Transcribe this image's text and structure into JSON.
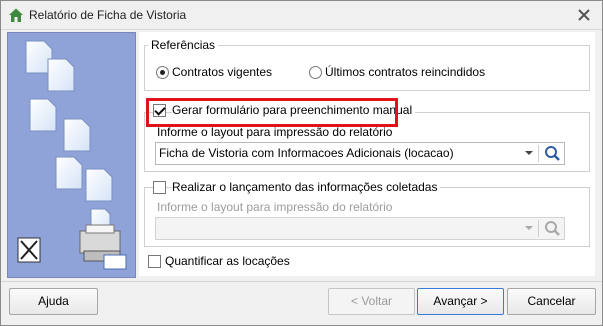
{
  "window": {
    "title": "Relatório de Ficha de Vistoria"
  },
  "referencias": {
    "legend": "Referências",
    "options": [
      {
        "label": "Contratos vigentes",
        "selected": true
      },
      {
        "label": "Últimos contratos reincindidos",
        "selected": false
      }
    ]
  },
  "gerar": {
    "label": "Gerar formulário para preenchimento manual",
    "checked": true,
    "layout_label": "Informe o layout para impressão do relatório",
    "layout_value": "Ficha de Vistoria com Informacoes Adicionais (locacao)"
  },
  "realizar": {
    "label": "Realizar o lançamento das informações coletadas",
    "checked": false,
    "layout_label": "Informe o layout para impressão do relatório",
    "layout_value": ""
  },
  "quantificar": {
    "label": "Quantificar as locações",
    "checked": false
  },
  "buttons": {
    "help": "Ajuda",
    "back": "< Voltar",
    "next": "Avançar >",
    "cancel": "Cancelar"
  },
  "colors": {
    "highlight": "#e0121a",
    "side_panel": "#8fa3d8"
  }
}
